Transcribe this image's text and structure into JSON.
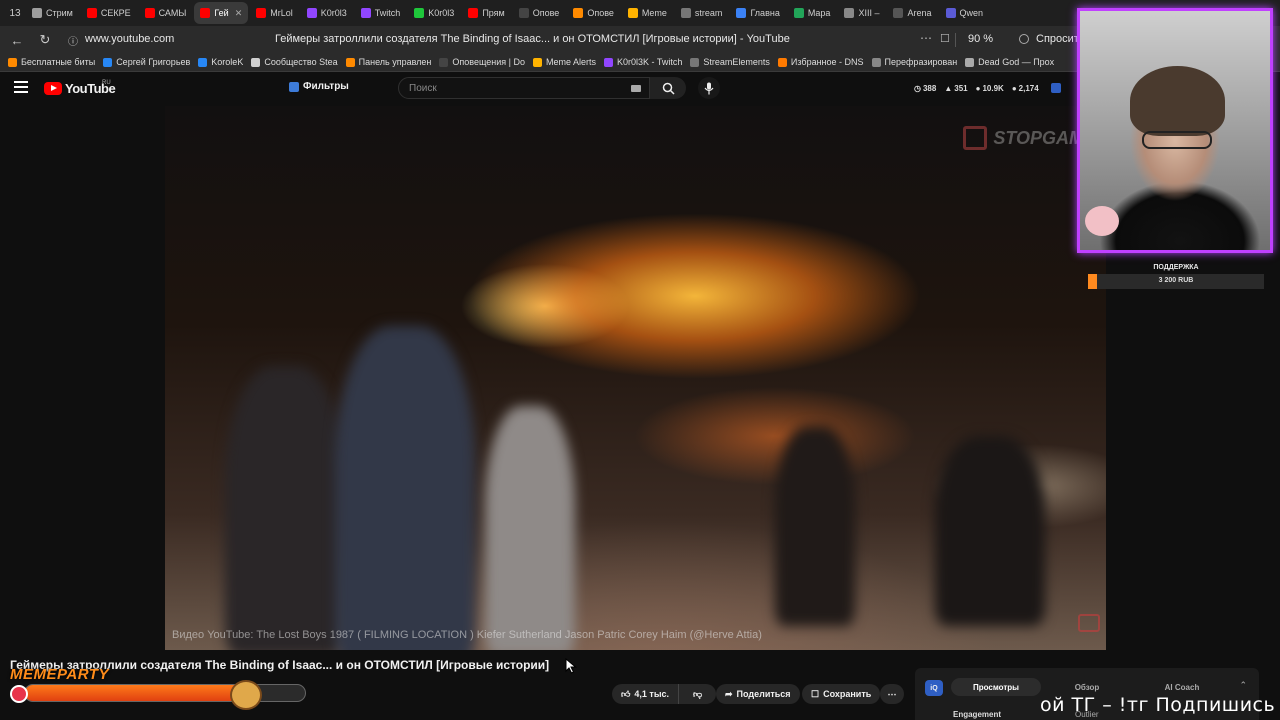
{
  "browser": {
    "tab_count": "13",
    "tabs": [
      {
        "label": "Стрим",
        "color": "#9e9e9e",
        "active": false
      },
      {
        "label": "СЕКРЕ",
        "color": "#ff0000",
        "active": false
      },
      {
        "label": "САМЫ",
        "color": "#ff0000",
        "active": false
      },
      {
        "label": "Гей",
        "color": "#ff0000",
        "active": true
      },
      {
        "label": "MrLol",
        "color": "#ff0000",
        "active": false
      },
      {
        "label": "K0r0l3",
        "color": "#9146ff",
        "active": false
      },
      {
        "label": "Twitch",
        "color": "#9146ff",
        "active": false
      },
      {
        "label": "K0r0l3",
        "color": "#1fc73b",
        "active": false
      },
      {
        "label": "Прям",
        "color": "#ff0000",
        "active": false
      },
      {
        "label": "Опове",
        "color": "#444444",
        "active": false
      },
      {
        "label": "Опове",
        "color": "#ff8a00",
        "active": false
      },
      {
        "label": "Meme",
        "color": "#ffb300",
        "active": false
      },
      {
        "label": "stream",
        "color": "#777777",
        "active": false
      },
      {
        "label": "Главна",
        "color": "#3b82f6",
        "active": false
      },
      {
        "label": "Мара",
        "color": "#22a559",
        "active": false
      },
      {
        "label": "XIII – ",
        "color": "#888888",
        "active": false
      },
      {
        "label": "Arena",
        "color": "#555555",
        "active": false
      },
      {
        "label": "Qwen",
        "color": "#5b5bd6",
        "active": false
      }
    ],
    "url": "www.youtube.com",
    "page_title": "Геймеры затроллили создателя The Binding of Isaac... и он ОТОМСТИЛ [Игровые истории] - YouTube",
    "zoom": "90 %",
    "ask_label": "Спросит",
    "bookmarks": [
      {
        "label": "Бесплатные биты",
        "color": "#ff8a00"
      },
      {
        "label": "Сергей Григорьев",
        "color": "#2787f5"
      },
      {
        "label": "KoroleK",
        "color": "#2787f5"
      },
      {
        "label": "Сообщество Stea",
        "color": "#d0d0d0"
      },
      {
        "label": "Панель управлен",
        "color": "#ff8a00"
      },
      {
        "label": "Оповещения | Do",
        "color": "#444444"
      },
      {
        "label": "Meme Alerts",
        "color": "#ffb300"
      },
      {
        "label": "K0r0l3K - Twitch",
        "color": "#9146ff"
      },
      {
        "label": "StreamElements",
        "color": "#777777"
      },
      {
        "label": "Избранное - DNS",
        "color": "#ff7a00"
      },
      {
        "label": "Перефразирован",
        "color": "#888888"
      },
      {
        "label": "Dead God — Прох",
        "color": "#aaaaaa"
      }
    ]
  },
  "youtube": {
    "logo_text": "YouTube",
    "logo_region": "RU",
    "filters_label": "Фильтры",
    "search_placeholder": "Поиск",
    "stats": [
      "388",
      "351",
      "10.9K",
      "2,174"
    ]
  },
  "video": {
    "watermark": "STOPGAME",
    "caption": "Видео YouTube: The Lost Boys 1987 ( FILMING LOCATION ) Kiefer Sutherland Jason Patric Corey Haim (@Herve Attia)",
    "title": "Геймеры затроллили создателя The Binding of Isaac... и он ОТОМСТИЛ [Игровые истории]"
  },
  "actions": {
    "likes": "4,1 тыс.",
    "share": "Поделиться",
    "save": "Сохранить"
  },
  "stream_overlay": {
    "donation_label": "ПОДДЕРЖКА",
    "donation_amount": "3 200 RUB",
    "donation_progress": 0.05,
    "meme_label": "MEMEPARTY",
    "meme_progress": 0.78,
    "ticker": "ой ТГ – !тг Подпишись на"
  },
  "extension": {
    "logo": "iQ",
    "tabs": [
      "Просмотры",
      "Обзор",
      "AI Coach"
    ],
    "sub": "Engagement",
    "sub2": "Outlier"
  },
  "colors": {
    "accent": "#c040ff",
    "youtube_red": "#ff0000",
    "donation": "#ff8a1f"
  }
}
